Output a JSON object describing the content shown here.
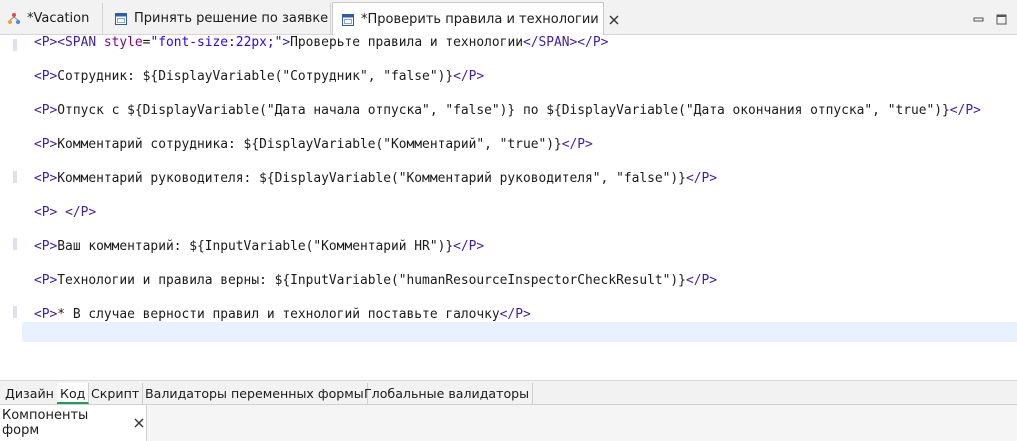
{
  "colors": {
    "tag": "#3f1ea5",
    "attribute": "#7f007f",
    "string": "#2a00ff",
    "active_subtab_underline": "#1e9d5a",
    "current_line": "#e8f2fe"
  },
  "editor_tabs": [
    {
      "label": "*Vacation",
      "icon": "process-icon"
    },
    {
      "label": "Принять решение по заявке",
      "icon": "form-icon"
    },
    {
      "label": "*Проверить правила и технологии",
      "icon": "form-icon",
      "active": true
    }
  ],
  "code_lines": [
    {
      "a": "<P><SPAN ",
      "b": "style",
      "c": "=",
      "d": "\"font-size:22px;\"",
      "e": ">",
      "f": "Проверьте правила и технологии",
      "g": "</SPAN></P>"
    },
    {
      "a": "<P>",
      "f": "Сотрудник: ${DisplayVariable(\"Сотрудник\", \"false\")}",
      "g": "</P>"
    },
    {
      "a": "<P>",
      "f": "Отпуск с ${DisplayVariable(\"Дата начала отпуска\", \"false\")} по ${DisplayVariable(\"Дата окончания отпуска\", \"true\")}",
      "g": "</P>"
    },
    {
      "a": "<P>",
      "f": "Комментарий сотрудника: ${DisplayVariable(\"Комментарий\", \"true\")}",
      "g": "</P>"
    },
    {
      "a": "<P>",
      "f": "Комментарий руководителя: ${DisplayVariable(\"Комментарий руководителя\", \"false\")}",
      "g": "</P>"
    },
    {
      "a": "<P>",
      "f": " ",
      "g": "</P>"
    },
    {
      "a": "<P>",
      "f": "Ваш комментарий: ${InputVariable(\"Комментарий HR\")}",
      "g": "</P>"
    },
    {
      "a": "<P>",
      "f": "Технологии и правила верны: ${InputVariable(\"humanResourceInspectorCheckResult\")}",
      "g": "</P>"
    },
    {
      "a": "<P>",
      "f": "* В случае верности правил и технологий поставьте галочку",
      "g": "</P>"
    }
  ],
  "sub_tabs": [
    "Дизайн",
    "Код",
    "Скрипт",
    "Валидаторы переменных формы",
    "Глобальные валидаторы"
  ],
  "active_sub_tab": "Код",
  "panel": {
    "title": "Компоненты форм"
  }
}
